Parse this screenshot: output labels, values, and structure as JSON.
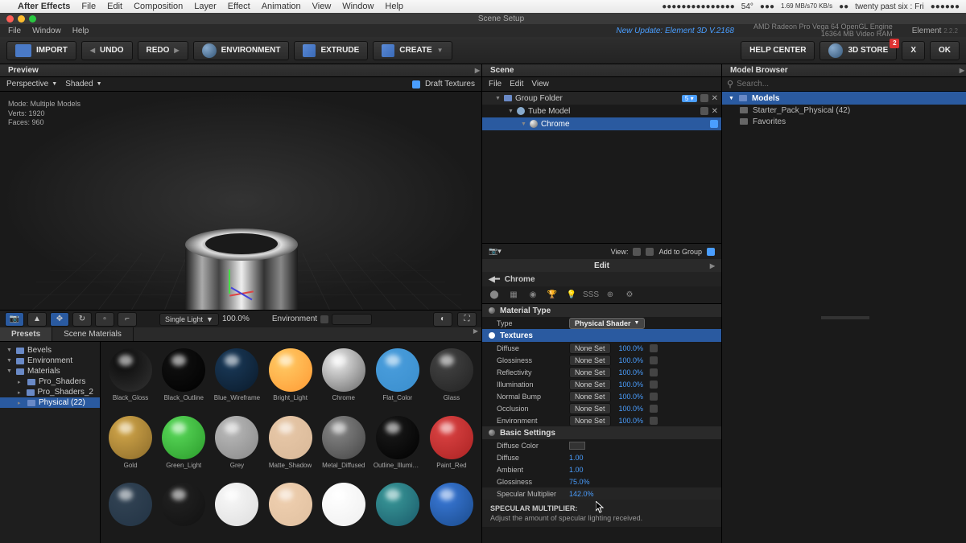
{
  "menubar": {
    "app": "After Effects",
    "items": [
      "File",
      "Edit",
      "Composition",
      "Layer",
      "Effect",
      "Animation",
      "View",
      "Window",
      "Help"
    ],
    "status_temp": "54°",
    "status_time": "twenty past six : Fri",
    "status_net1": "1.69 MB/s",
    "status_net2": "70 KB/s"
  },
  "titlebar": {
    "title": "Scene Setup"
  },
  "submenu": {
    "items": [
      "File",
      "Window",
      "Help"
    ],
    "update": "New Update: Element 3D V.2168",
    "gpu1": "AMD Radeon Pro Vega 64 OpenGL Engine",
    "gpu2": "16364 MB Video RAM",
    "element": "Element",
    "version": "2.2.2"
  },
  "toolbar": {
    "import": "IMPORT",
    "undo": "UNDO",
    "redo": "REDO",
    "environment": "ENVIRONMENT",
    "extrude": "EXTRUDE",
    "create": "CREATE",
    "help": "HELP CENTER",
    "store": "3D STORE",
    "store_badge": "2",
    "close": "X",
    "ok": "OK"
  },
  "preview": {
    "title": "Preview",
    "perspective": "Perspective",
    "shaded": "Shaded",
    "draft": "Draft Textures",
    "stats_mode": "Mode:  Multiple Models",
    "stats_verts": "Verts: 1920",
    "stats_faces": "Faces: 960",
    "light": "Single Light",
    "light_pct": "100.0%",
    "env": "Environment"
  },
  "presets": {
    "tabs": [
      "Presets",
      "Scene Materials"
    ],
    "tree": [
      {
        "label": "Bevels",
        "lvl": 0,
        "sel": false
      },
      {
        "label": "Environment",
        "lvl": 0,
        "sel": false
      },
      {
        "label": "Materials",
        "lvl": 0,
        "sel": false
      },
      {
        "label": "Pro_Shaders",
        "lvl": 1,
        "sel": false
      },
      {
        "label": "Pro_Shaders_2",
        "lvl": 1,
        "sel": false
      },
      {
        "label": "Physical (22)",
        "lvl": 1,
        "sel": true
      }
    ],
    "materials": [
      {
        "name": "Black_Gloss",
        "c1": "#0a0a0a",
        "c2": "#333"
      },
      {
        "name": "Black_Outline",
        "c1": "#111",
        "c2": "#000"
      },
      {
        "name": "Blue_Wireframe",
        "c1": "#1a3a5a",
        "c2": "#0a1a2a"
      },
      {
        "name": "Bright_Light",
        "c1": "#ffcc66",
        "c2": "#ff9933"
      },
      {
        "name": "Chrome",
        "c1": "#eee",
        "c2": "#666"
      },
      {
        "name": "Flat_Color",
        "c1": "#4a9edd",
        "c2": "#3a8ecd"
      },
      {
        "name": "Glass",
        "c1": "#444",
        "c2": "#222"
      },
      {
        "name": "Gold",
        "c1": "#d4a84a",
        "c2": "#8a6a2a"
      },
      {
        "name": "Green_Light",
        "c1": "#5ada5a",
        "c2": "#2a9a2a"
      },
      {
        "name": "Grey",
        "c1": "#bbb",
        "c2": "#888"
      },
      {
        "name": "Matte_Shadow",
        "c1": "#e8c8a8",
        "c2": "#d8b898"
      },
      {
        "name": "Metal_Diffused",
        "c1": "#888",
        "c2": "#444"
      },
      {
        "name": "Outline_Illuminat...",
        "c1": "#1a1a1a",
        "c2": "#000"
      },
      {
        "name": "Paint_Red",
        "c1": "#dd4444",
        "c2": "#aa2222"
      },
      {
        "name": "",
        "c1": "#334455",
        "c2": "#223344"
      },
      {
        "name": "",
        "c1": "#222",
        "c2": "#111"
      },
      {
        "name": "",
        "c1": "#f8f8f8",
        "c2": "#ddd"
      },
      {
        "name": "",
        "c1": "#f0d0b0",
        "c2": "#e0c0a0"
      },
      {
        "name": "",
        "c1": "#fff",
        "c2": "#eee"
      },
      {
        "name": "",
        "c1": "#3a9a9a",
        "c2": "#1a5a6a"
      },
      {
        "name": "",
        "c1": "#3a7ada",
        "c2": "#1a4a8a"
      }
    ]
  },
  "scene": {
    "title": "Scene",
    "menubar": [
      "File",
      "Edit",
      "View"
    ],
    "items": [
      {
        "label": "Group Folder",
        "lvl": 0,
        "type": "group",
        "badge": "5"
      },
      {
        "label": "Tube Model",
        "lvl": 1,
        "type": "model"
      },
      {
        "label": "Chrome",
        "lvl": 2,
        "type": "material",
        "selected": true
      }
    ],
    "view_label": "View:",
    "add_group": "Add to Group"
  },
  "edit": {
    "title": "Edit",
    "mat_name": "Chrome",
    "material_type_label": "Material Type",
    "type_label": "Type",
    "type_value": "Physical Shader",
    "textures_label": "Textures",
    "textures": [
      {
        "name": "Diffuse",
        "val": "None Set",
        "pct": "100.0%"
      },
      {
        "name": "Glossiness",
        "val": "None Set",
        "pct": "100.0%"
      },
      {
        "name": "Reflectivity",
        "val": "None Set",
        "pct": "100.0%"
      },
      {
        "name": "Illumination",
        "val": "None Set",
        "pct": "100.0%"
      },
      {
        "name": "Normal Bump",
        "val": "None Set",
        "pct": "100.0%"
      },
      {
        "name": "Occlusion",
        "val": "None Set",
        "pct": "100.0%"
      },
      {
        "name": "Environment",
        "val": "None Set",
        "pct": "100.0%"
      }
    ],
    "basic_label": "Basic Settings",
    "basic": [
      {
        "name": "Diffuse Color",
        "type": "swatch"
      },
      {
        "name": "Diffuse",
        "val": "1.00"
      },
      {
        "name": "Ambient",
        "val": "1.00"
      },
      {
        "name": "Glossiness",
        "val": "75.0%"
      },
      {
        "name": "Specular Multiplier",
        "val": "142.0%",
        "hl": true
      }
    ],
    "help_title": "SPECULAR MULTIPLIER:",
    "help_text": "Adjust the amount of specular lighting received."
  },
  "browser": {
    "title": "Model Browser",
    "search_placeholder": "Search...",
    "models_label": "Models",
    "items": [
      "Starter_Pack_Physical (42)",
      "Favorites"
    ]
  }
}
